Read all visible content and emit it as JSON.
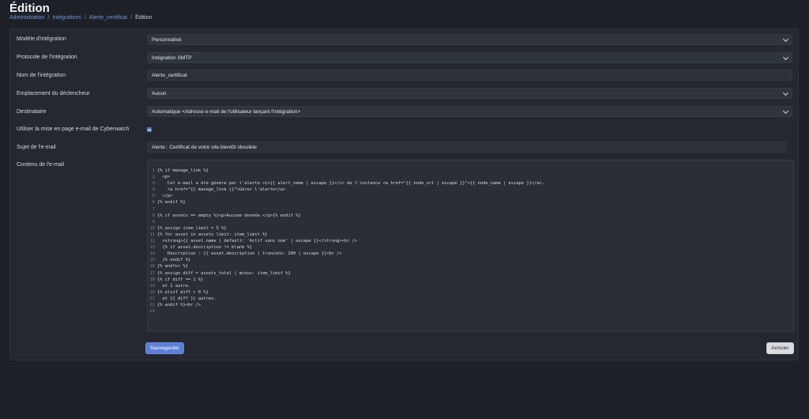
{
  "page": {
    "title": "Édition",
    "breadcrumb": [
      "Administration",
      "Intégrations",
      "Alerte_certificat",
      "Édition"
    ]
  },
  "form": {
    "model_label": "Modèle d'intégration",
    "model_value": "Personnalisé",
    "protocol_label": "Protocole de l'intégration",
    "protocol_value": "Intégration SMTP",
    "name_label": "Nom de l'intégration",
    "name_value": "Alerte_certificat",
    "trigger_label": "Emplacement du déclencheur",
    "trigger_value": "Aucun",
    "recipient_label": "Destinataire",
    "recipient_value": "Automatique <Adresse e-mail de l'utilisateur lançant l'intégration>",
    "layout_label": "Utiliser la mise en page e-mail de Cyberwatch",
    "layout_checked": true,
    "subject_label": "Sujet de l'e-mail",
    "subject_value": "Alerte : Certificat de votre site bientôt obsolète",
    "content_label": "Contenu de l'e-mail"
  },
  "code_lines": [
    "{% if manage_link %}",
    "  <p>",
    "    Cet e-mail a été généré par l'alerte <i>{{ alert_name | escape }}</i> de l'instance <a href=\"{{ node_url | escape }}\">{{ node_name | escape }}</a>.",
    "    <a href=\"{{ manage_link }}\">Gérer l'alerte</a>",
    "  </p>",
    "{% endif %}",
    "",
    "{% if assets == empty %}<p>Aucune donnée.</p>{% endif %}",
    "",
    "{% assign item_limit = 5 %}",
    "{% for asset in assets limit: item_limit %}",
    "  <strong>{{ asset.name | default: 'Actif sans nom' | escape }}</strong><br />",
    "  {% if asset.description != blank %}",
    "    Description : {{ asset.description | truncate: 200 | escape }}<br />",
    "  {% endif %}",
    "{% endfor %}",
    "{% assign diff = assets_total | minus: item_limit %}",
    "{% if diff == 1 %}",
    "  et 1 autre.",
    "{% elsif diff > 0 %}",
    "  et {{ diff }} autres.",
    "{% endif %}<br />",
    ""
  ],
  "buttons": {
    "save_label": "Sauvegarder",
    "cancel_label": "Annuler"
  },
  "colors": {
    "accent": "#5b7fd7",
    "link": "#6d98e0",
    "background": "#1d2027",
    "card": "#252830"
  }
}
